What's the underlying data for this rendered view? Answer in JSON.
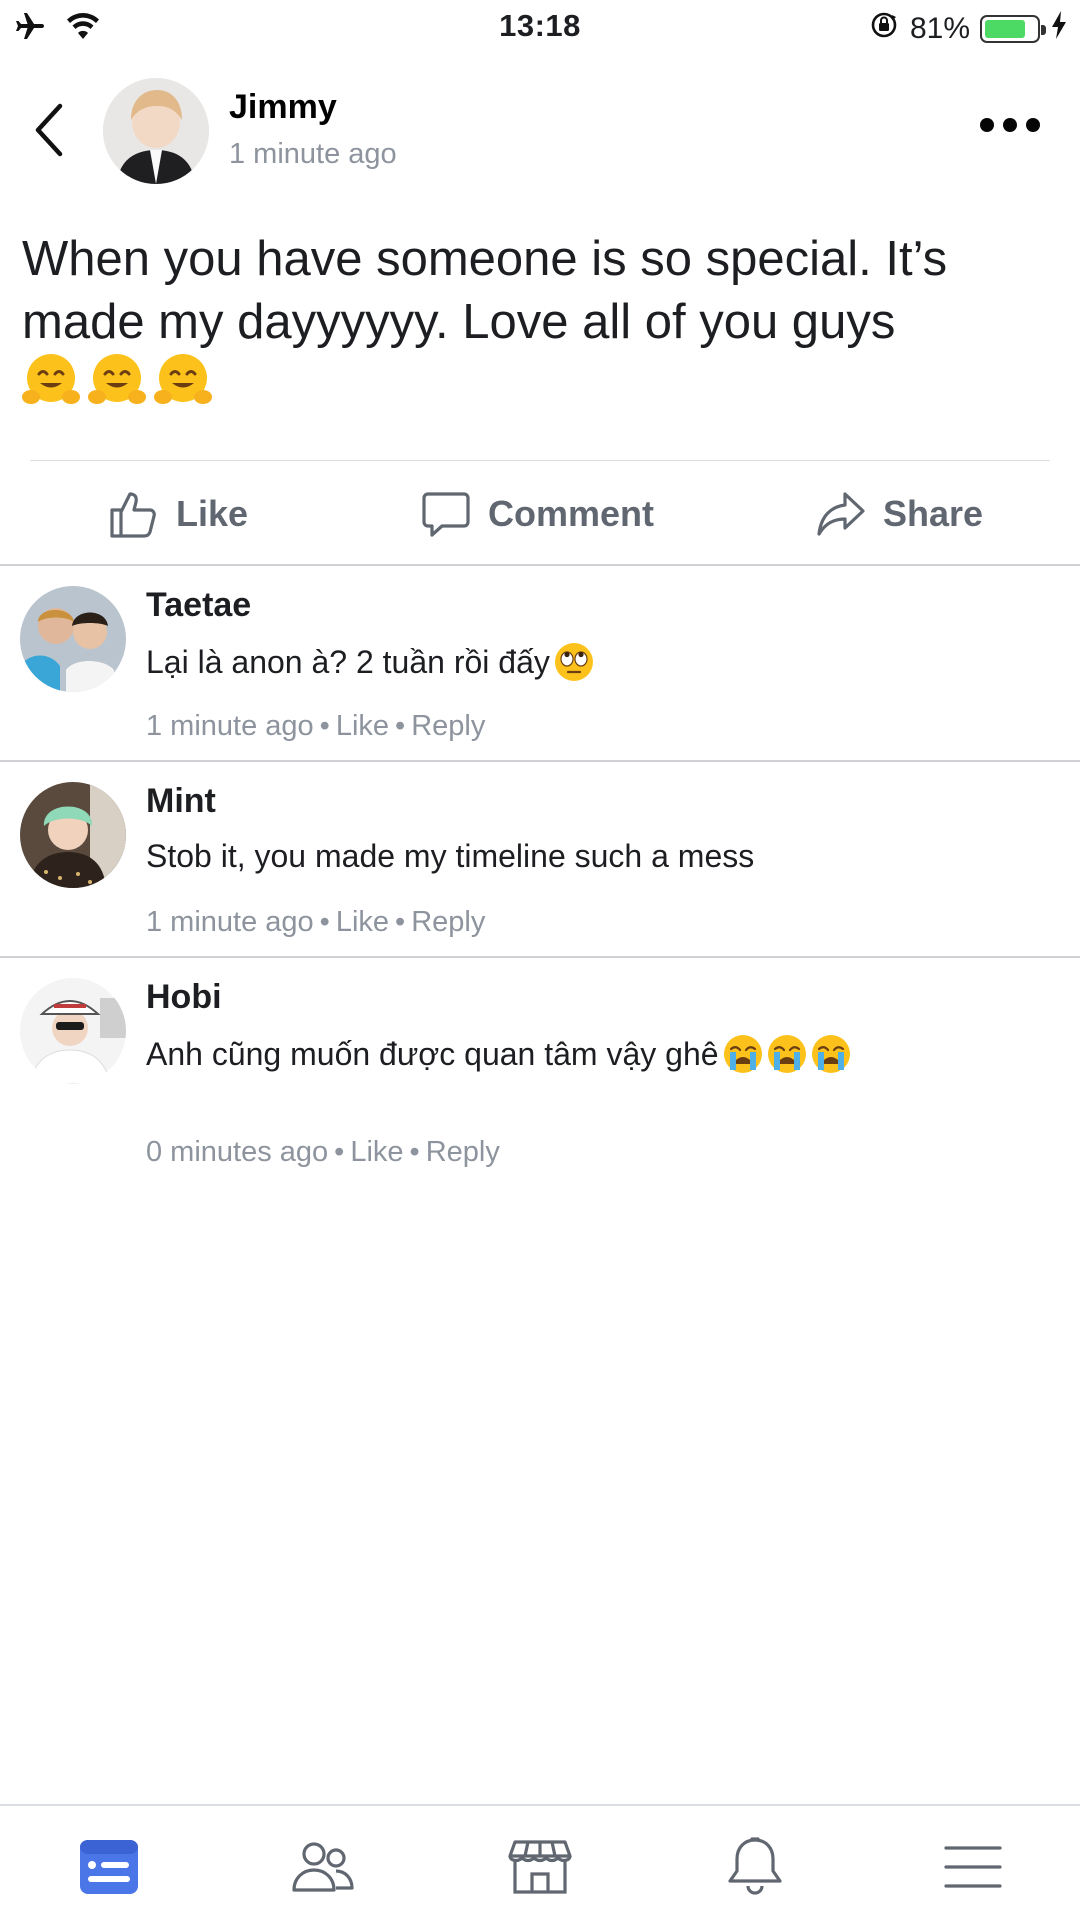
{
  "status_bar": {
    "time": "13:18",
    "battery_percent": "81%",
    "battery_level": 0.81,
    "icons": [
      "airplane-icon",
      "wifi-icon",
      "rotation-lock-icon",
      "battery-icon",
      "charging-icon"
    ]
  },
  "post": {
    "author": "Jimmy",
    "time": "1 minute ago",
    "text": "When you have someone is so special. It’s made my dayyyyyy. Love all of you guys",
    "emojis": [
      "hugging-face",
      "hugging-face",
      "hugging-face"
    ]
  },
  "actions": {
    "like": "Like",
    "comment": "Comment",
    "share": "Share"
  },
  "comments": [
    {
      "name": "Taetae",
      "text": "Lại là anon à? 2 tuần rồi đấy",
      "emojis": [
        "eye-roll-face"
      ],
      "time": "1 minute ago",
      "like": "Like",
      "reply": "Reply",
      "sep": "•"
    },
    {
      "name": "Mint",
      "text": "Stob it, you made my timeline such a mess",
      "emojis": [],
      "time": "1 minute ago",
      "like": "Like",
      "reply": "Reply",
      "sep": "•"
    },
    {
      "name": "Hobi",
      "text": "Anh cũng muốn được quan tâm vậy ghê",
      "emojis": [
        "crying-face",
        "crying-face",
        "crying-face"
      ],
      "time": "0 minutes ago",
      "like": "Like",
      "reply": "Reply",
      "sep": "•"
    }
  ],
  "tab_bar": {
    "tabs": [
      "news-feed-icon",
      "friends-icon",
      "marketplace-icon",
      "notifications-icon",
      "menu-icon"
    ],
    "active": "news-feed-icon",
    "active_color": "#4a76e8",
    "inactive_color": "#606770"
  }
}
